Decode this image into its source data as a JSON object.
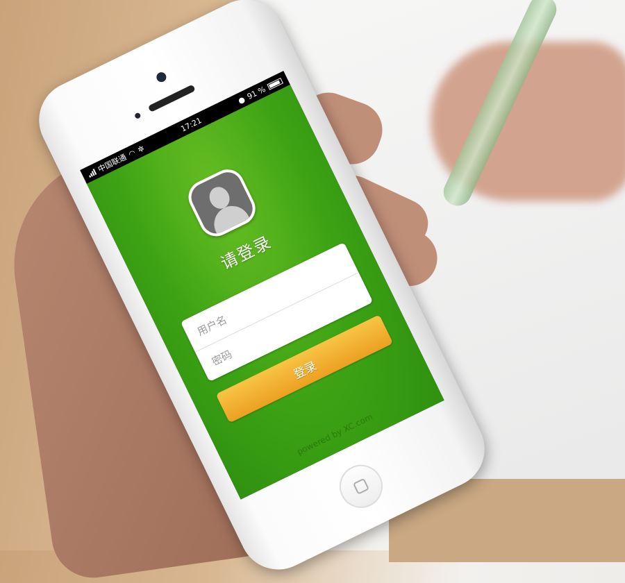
{
  "status_bar": {
    "carrier": "中国联通",
    "time": "17:21",
    "battery": "91 %"
  },
  "login": {
    "title": "请登录",
    "username_placeholder": "用户名",
    "password_placeholder": "密码",
    "login_button": "登录",
    "footer": "powered by XC.com"
  },
  "colors": {
    "accent_green": "#3da314",
    "button_orange": "#f0aa2a"
  }
}
